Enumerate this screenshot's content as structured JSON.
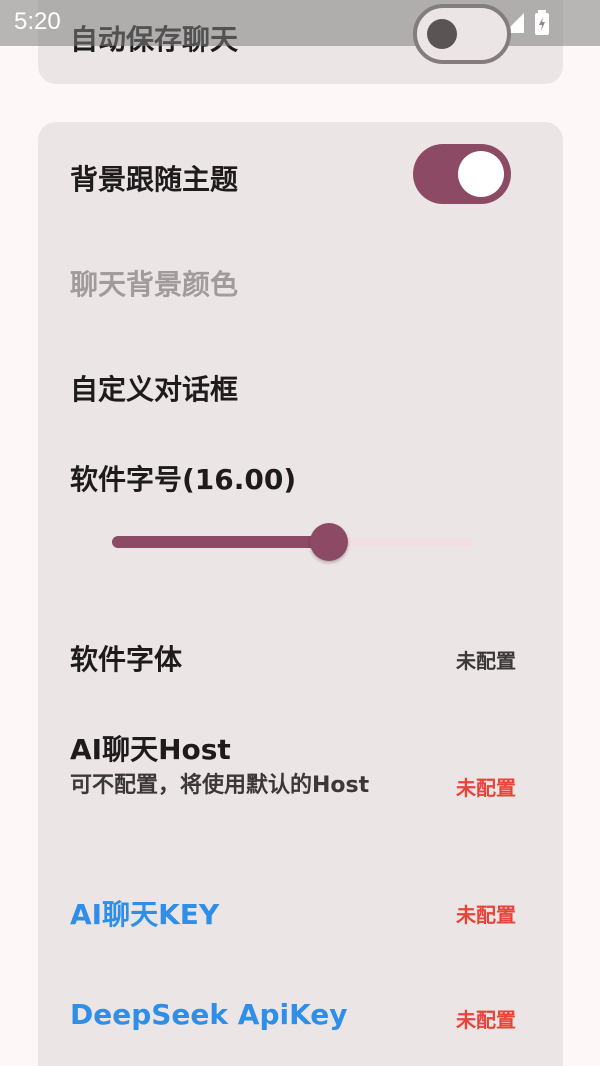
{
  "status_bar": {
    "time": "5:20",
    "icons": [
      "wifi-icon",
      "signal-icon",
      "battery-icon"
    ]
  },
  "top_card": {
    "title": "自动保存聊天",
    "toggle_on": false
  },
  "settings": {
    "follow_theme_title": "背景跟随主题",
    "follow_theme_on": true,
    "chat_bg_color_title": "聊天背景颜色",
    "custom_dialog_title": "自定义对话框",
    "font_size_title": "软件字号(16.00)",
    "font_size_value": 16.0,
    "font_size_slider_fraction": 0.6,
    "font_title": "软件字体",
    "font_value": "未配置",
    "ai_host_title": "AI聊天Host",
    "ai_host_subtitle": "可不配置，将使用默认的Host",
    "ai_host_value": "未配置",
    "ai_key_title": "AI聊天KEY",
    "ai_key_value": "未配置",
    "deepseek_title": "DeepSeek ApiKey",
    "deepseek_value": "未配置"
  },
  "colors": {
    "accent": "#8c4a64",
    "card_bg": "#ece5e5",
    "link_blue": "#2f8fe8",
    "warning_red": "#e8443a"
  }
}
